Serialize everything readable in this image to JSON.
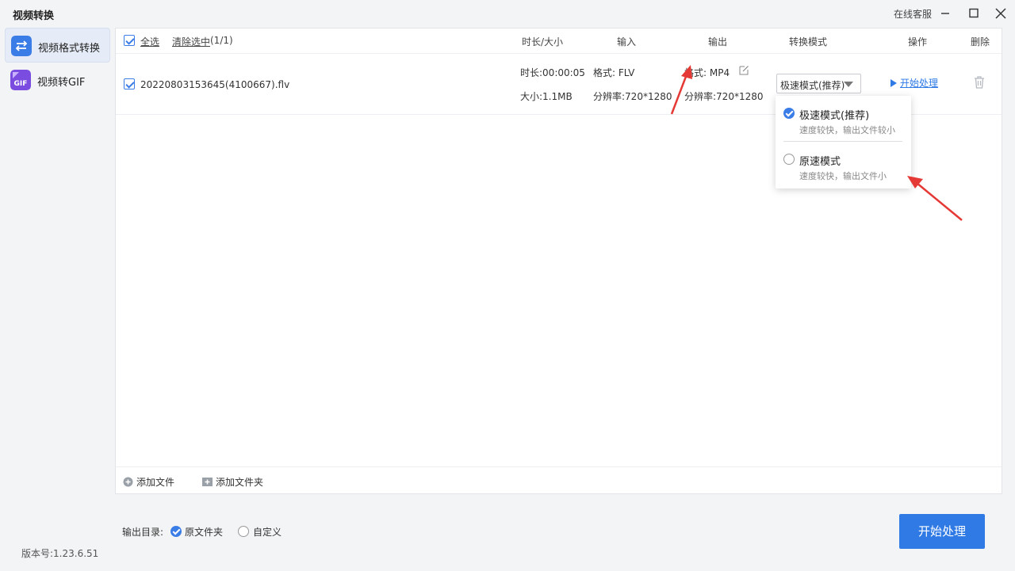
{
  "titlebar": {
    "title": "视频转换",
    "support": "在线客服"
  },
  "sidebar": {
    "items": [
      {
        "label": "视频格式转换",
        "icon": "swap-arrows-icon"
      },
      {
        "label": "视频转GIF",
        "icon": "gif-icon"
      }
    ],
    "version": "版本号:1.23.6.51"
  },
  "table": {
    "select_all": "全选",
    "clear_selected": "清除选中",
    "count": "(1/1)",
    "headers": {
      "duration_size": "时长/大小",
      "input": "输入",
      "output": "输出",
      "mode": "转换模式",
      "action": "操作",
      "delete": "删除"
    }
  },
  "file": {
    "name": "20220803153645(4100667).flv",
    "duration": "时长:00:00:05",
    "size": "大小:1.1MB",
    "input_format": "格式: FLV",
    "input_resolution": "分辨率:720*1280",
    "output_format": "格式: MP4",
    "output_resolution": "分辨率:720*1280",
    "mode": "极速模式(推荐)",
    "start": "开始处理"
  },
  "dropdown": {
    "options": [
      {
        "title": "极速模式(推荐)",
        "desc": "速度较快，输出文件较小",
        "selected": true
      },
      {
        "title": "原速模式",
        "desc": "速度较快，输出文件小",
        "selected": false
      }
    ]
  },
  "footer": {
    "add_file": "添加文件",
    "add_folder": "添加文件夹",
    "output_dir_label": "输出目录:",
    "option_original": "原文件夹",
    "option_custom": "自定义",
    "selected_output_dir": "原文件夹",
    "start_button": "开始处理"
  },
  "colors": {
    "accent": "#2f7ae5",
    "annotation_arrow": "#e53935"
  }
}
